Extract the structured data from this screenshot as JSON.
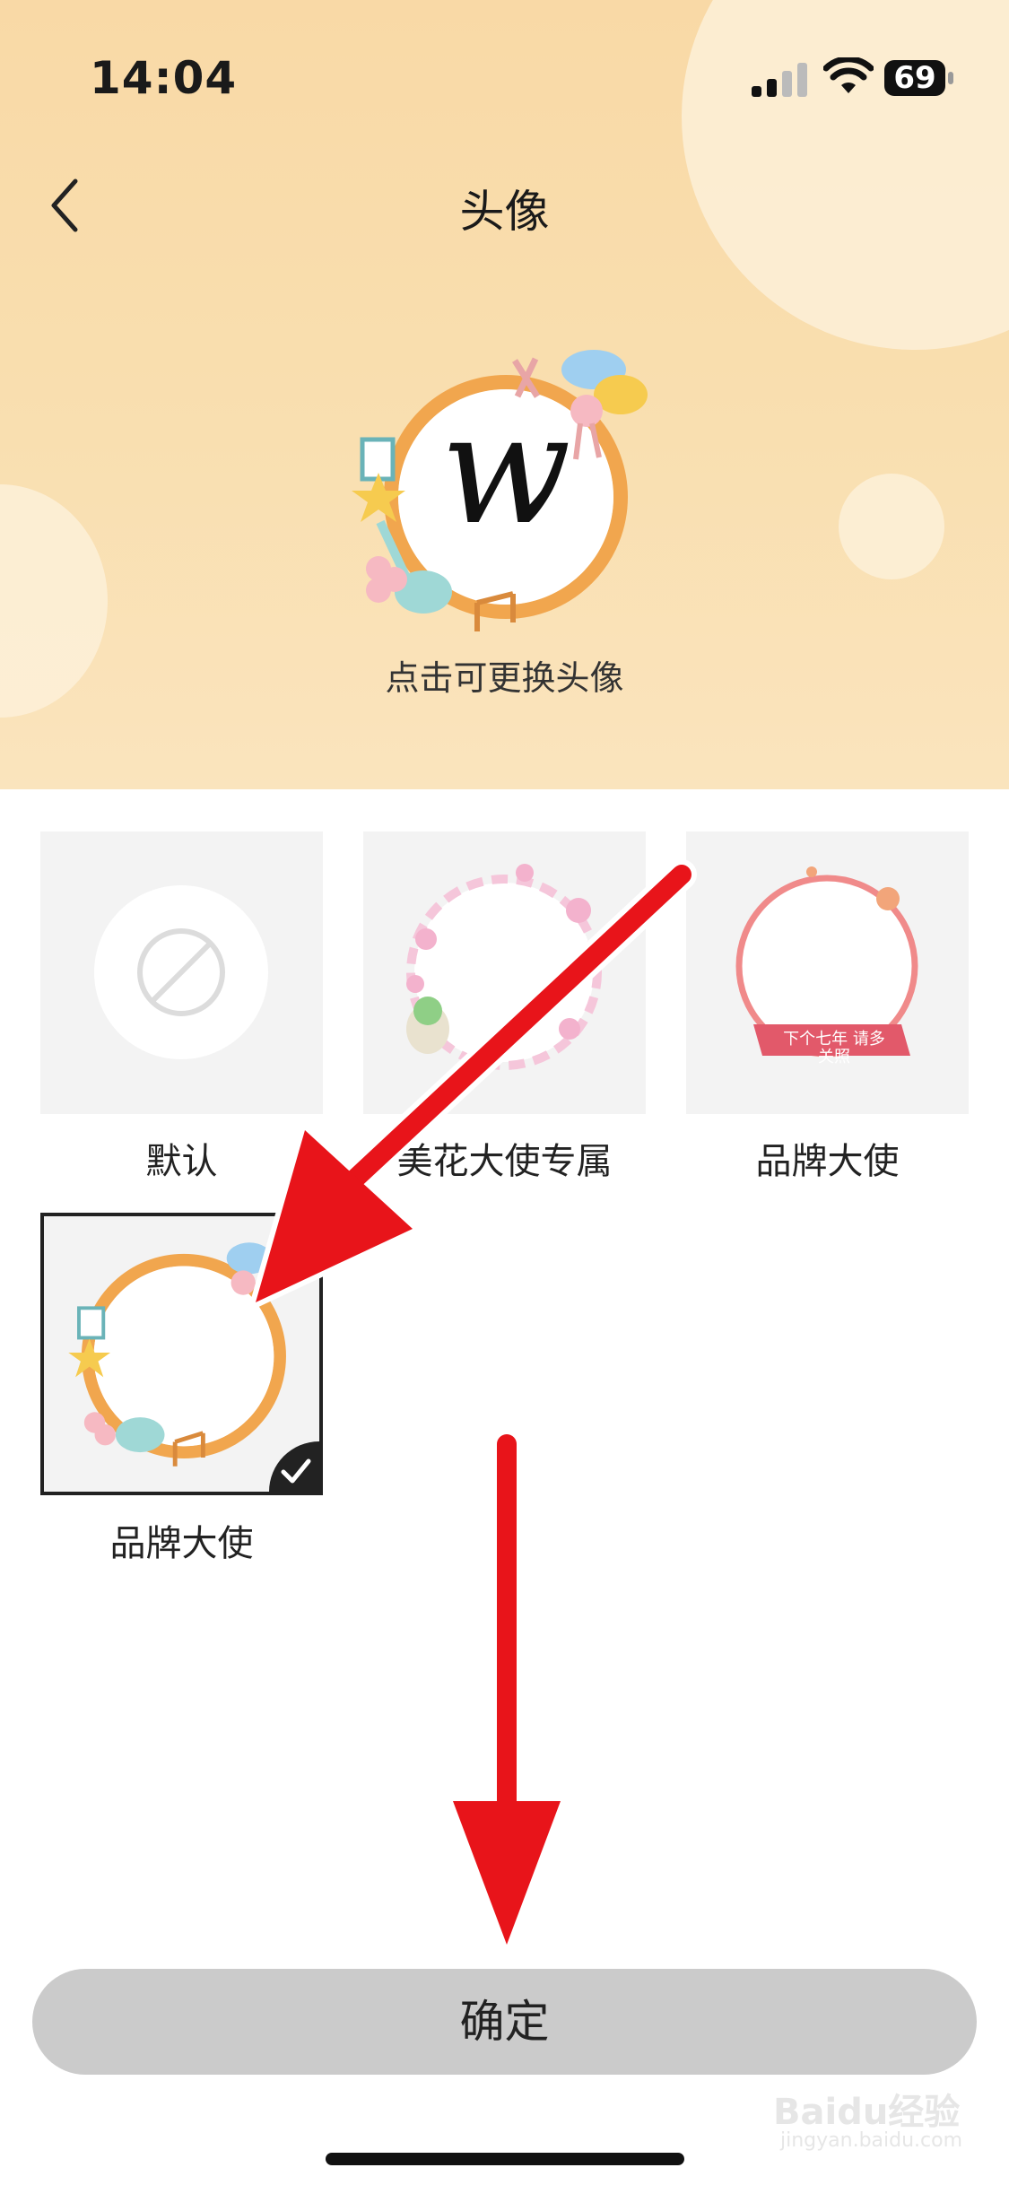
{
  "status_bar": {
    "time": "14:04",
    "battery": "69"
  },
  "header": {
    "title": "头像",
    "back_icon": "chevron-left-icon"
  },
  "avatar": {
    "letter": "w",
    "hint": "点击可更换头像"
  },
  "frames": [
    {
      "label": "默认",
      "icon": "no-frame-icon",
      "selected": false
    },
    {
      "label": "美花大使专属",
      "icon": "floral-frame",
      "selected": false
    },
    {
      "label": "品牌大使",
      "icon": "qixi-frame",
      "badge_text": "下个七年 请多关照",
      "selected": false
    },
    {
      "label": "品牌大使",
      "icon": "music-frame",
      "selected": true
    }
  ],
  "confirm_button": {
    "label": "确定"
  },
  "watermark": {
    "brand": "Baidu经验",
    "url": "jingyan.baidu.com"
  },
  "colors": {
    "header_bg": "#f9d9a6",
    "button_bg": "#cbcbcb",
    "annotation_arrow": "#e8141a"
  }
}
